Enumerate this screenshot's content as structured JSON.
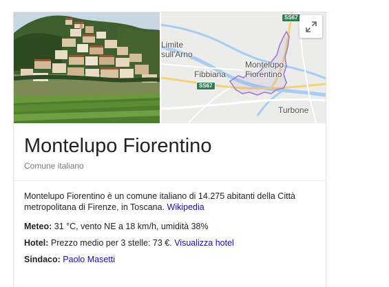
{
  "map": {
    "places": {
      "limite_line1": "Limite",
      "limite_line2": "sull'Arno",
      "fibbiana": "Fibbiana",
      "montelupo_line1": "Montelupo",
      "montelupo_line2": "Fiorentino",
      "turbone": "Turbone"
    },
    "road_shields": {
      "top": "SS67",
      "bottom": "SS67"
    },
    "expand_icon": "expand-icon"
  },
  "entity": {
    "title": "Montelupo Fiorentino",
    "subtitle": "Comune italiano",
    "description": "Montelupo Fiorentino è un comune italiano di 14.275 abitanti della Città metropolitana di Firenze, in Toscana.",
    "source_link": "Wikipedia"
  },
  "facts": {
    "meteo": {
      "label": "Meteo:",
      "value": "31 °C, vento NE a 18 km/h, umidità 38%"
    },
    "hotel": {
      "label": "Hotel:",
      "value": "Prezzo medio per 3 stelle: 73 €.",
      "link": "Visualizza hotel"
    },
    "sindaco": {
      "label": "Sindaco:",
      "link": "Paolo Masetti"
    }
  },
  "colors": {
    "link": "#1a0dab",
    "road_shield": "#2e7d4f",
    "boundary": "#9c7ec9",
    "river": "#a7cdf2",
    "subtitle": "#777777"
  }
}
